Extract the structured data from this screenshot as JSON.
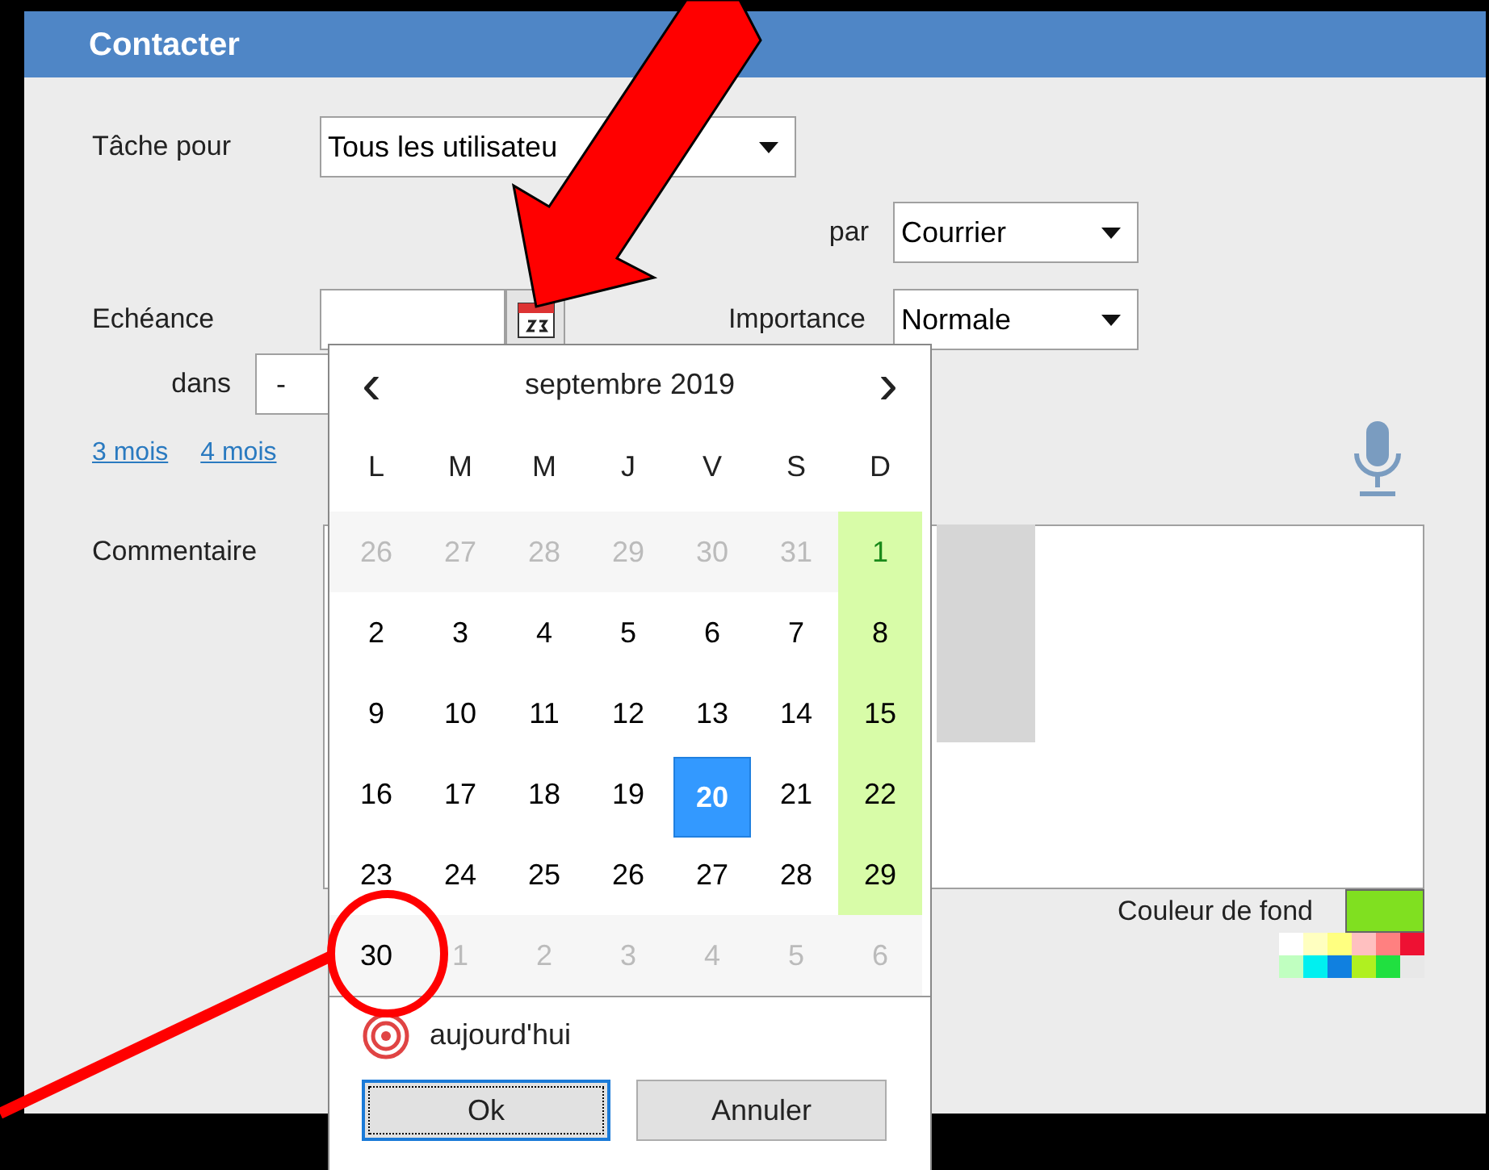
{
  "window": {
    "title": "Contacter"
  },
  "task_for": {
    "label": "Tâche pour",
    "value": "Tous les utilisateu"
  },
  "via": {
    "label": "par",
    "value": "Courrier"
  },
  "due": {
    "label": "Echéance"
  },
  "importance": {
    "label": "Importance",
    "value": "Normale"
  },
  "within": {
    "label": "dans",
    "value": "-"
  },
  "quick_links": [
    "3 mois",
    "4 mois"
  ],
  "comment": {
    "label": "Commentaire"
  },
  "background_color": {
    "label": "Couleur de fond",
    "color": "#80e020"
  },
  "palette": [
    {
      "color": "#ffffff"
    },
    {
      "color": "#ffffc0"
    },
    {
      "color": "#ffff80"
    },
    {
      "color": "#ffc0c0"
    },
    {
      "color": "#ff8080"
    },
    {
      "color": "#ee1133"
    },
    {
      "color": "#c0ffc0"
    },
    {
      "color": "#00f0f0"
    },
    {
      "color": "#1080e0"
    },
    {
      "color": "#b0f020"
    },
    {
      "color": "#20e040"
    },
    {
      "color": "#e8e8e8"
    }
  ],
  "calendar": {
    "month": "septembre 2019",
    "prev": "‹",
    "next": "›",
    "weekdays": [
      "L",
      "M",
      "M",
      "J",
      "V",
      "S",
      "D"
    ],
    "weeks": [
      [
        {
          "day": "26",
          "kind": "other",
          "weekend": false,
          "selected": false
        },
        {
          "day": "27",
          "kind": "other",
          "weekend": false,
          "selected": false
        },
        {
          "day": "28",
          "kind": "other",
          "weekend": false,
          "selected": false
        },
        {
          "day": "29",
          "kind": "other",
          "weekend": false,
          "selected": false
        },
        {
          "day": "30",
          "kind": "other",
          "weekend": false,
          "selected": false
        },
        {
          "day": "31",
          "kind": "other",
          "weekend": false,
          "selected": false
        },
        {
          "day": "1",
          "kind": "current",
          "weekend": true,
          "selected": false
        }
      ],
      [
        {
          "day": "2",
          "kind": "current",
          "weekend": false,
          "selected": false
        },
        {
          "day": "3",
          "kind": "current",
          "weekend": false,
          "selected": false
        },
        {
          "day": "4",
          "kind": "current",
          "weekend": false,
          "selected": false
        },
        {
          "day": "5",
          "kind": "current",
          "weekend": false,
          "selected": false
        },
        {
          "day": "6",
          "kind": "current",
          "weekend": false,
          "selected": false
        },
        {
          "day": "7",
          "kind": "current",
          "weekend": false,
          "selected": false
        },
        {
          "day": "8",
          "kind": "current",
          "weekend": true,
          "selected": false
        }
      ],
      [
        {
          "day": "9",
          "kind": "current",
          "weekend": false,
          "selected": false
        },
        {
          "day": "10",
          "kind": "current",
          "weekend": false,
          "selected": false
        },
        {
          "day": "11",
          "kind": "current",
          "weekend": false,
          "selected": false
        },
        {
          "day": "12",
          "kind": "current",
          "weekend": false,
          "selected": false
        },
        {
          "day": "13",
          "kind": "current",
          "weekend": false,
          "selected": false
        },
        {
          "day": "14",
          "kind": "current",
          "weekend": false,
          "selected": false
        },
        {
          "day": "15",
          "kind": "current",
          "weekend": true,
          "selected": false
        }
      ],
      [
        {
          "day": "16",
          "kind": "current",
          "weekend": false,
          "selected": false
        },
        {
          "day": "17",
          "kind": "current",
          "weekend": false,
          "selected": false
        },
        {
          "day": "18",
          "kind": "current",
          "weekend": false,
          "selected": false
        },
        {
          "day": "19",
          "kind": "current",
          "weekend": false,
          "selected": false
        },
        {
          "day": "20",
          "kind": "current",
          "weekend": false,
          "selected": true
        },
        {
          "day": "21",
          "kind": "current",
          "weekend": false,
          "selected": false
        },
        {
          "day": "22",
          "kind": "current",
          "weekend": true,
          "selected": false
        }
      ],
      [
        {
          "day": "23",
          "kind": "current",
          "weekend": false,
          "selected": false
        },
        {
          "day": "24",
          "kind": "current",
          "weekend": false,
          "selected": false
        },
        {
          "day": "25",
          "kind": "current",
          "weekend": false,
          "selected": false
        },
        {
          "day": "26",
          "kind": "current",
          "weekend": false,
          "selected": false
        },
        {
          "day": "27",
          "kind": "current",
          "weekend": false,
          "selected": false
        },
        {
          "day": "28",
          "kind": "current",
          "weekend": false,
          "selected": false
        },
        {
          "day": "29",
          "kind": "current",
          "weekend": true,
          "selected": false
        }
      ],
      [
        {
          "day": "30",
          "kind": "current",
          "weekend": false,
          "selected": false
        },
        {
          "day": "1",
          "kind": "other",
          "weekend": false,
          "selected": false
        },
        {
          "day": "2",
          "kind": "other",
          "weekend": false,
          "selected": false
        },
        {
          "day": "3",
          "kind": "other",
          "weekend": false,
          "selected": false
        },
        {
          "day": "4",
          "kind": "other",
          "weekend": false,
          "selected": false
        },
        {
          "day": "5",
          "kind": "other",
          "weekend": false,
          "selected": false
        },
        {
          "day": "6",
          "kind": "other",
          "weekend": false,
          "selected": false
        }
      ]
    ],
    "today": "aujourd'hui",
    "ok": "Ok",
    "cancel": "Annuler"
  }
}
